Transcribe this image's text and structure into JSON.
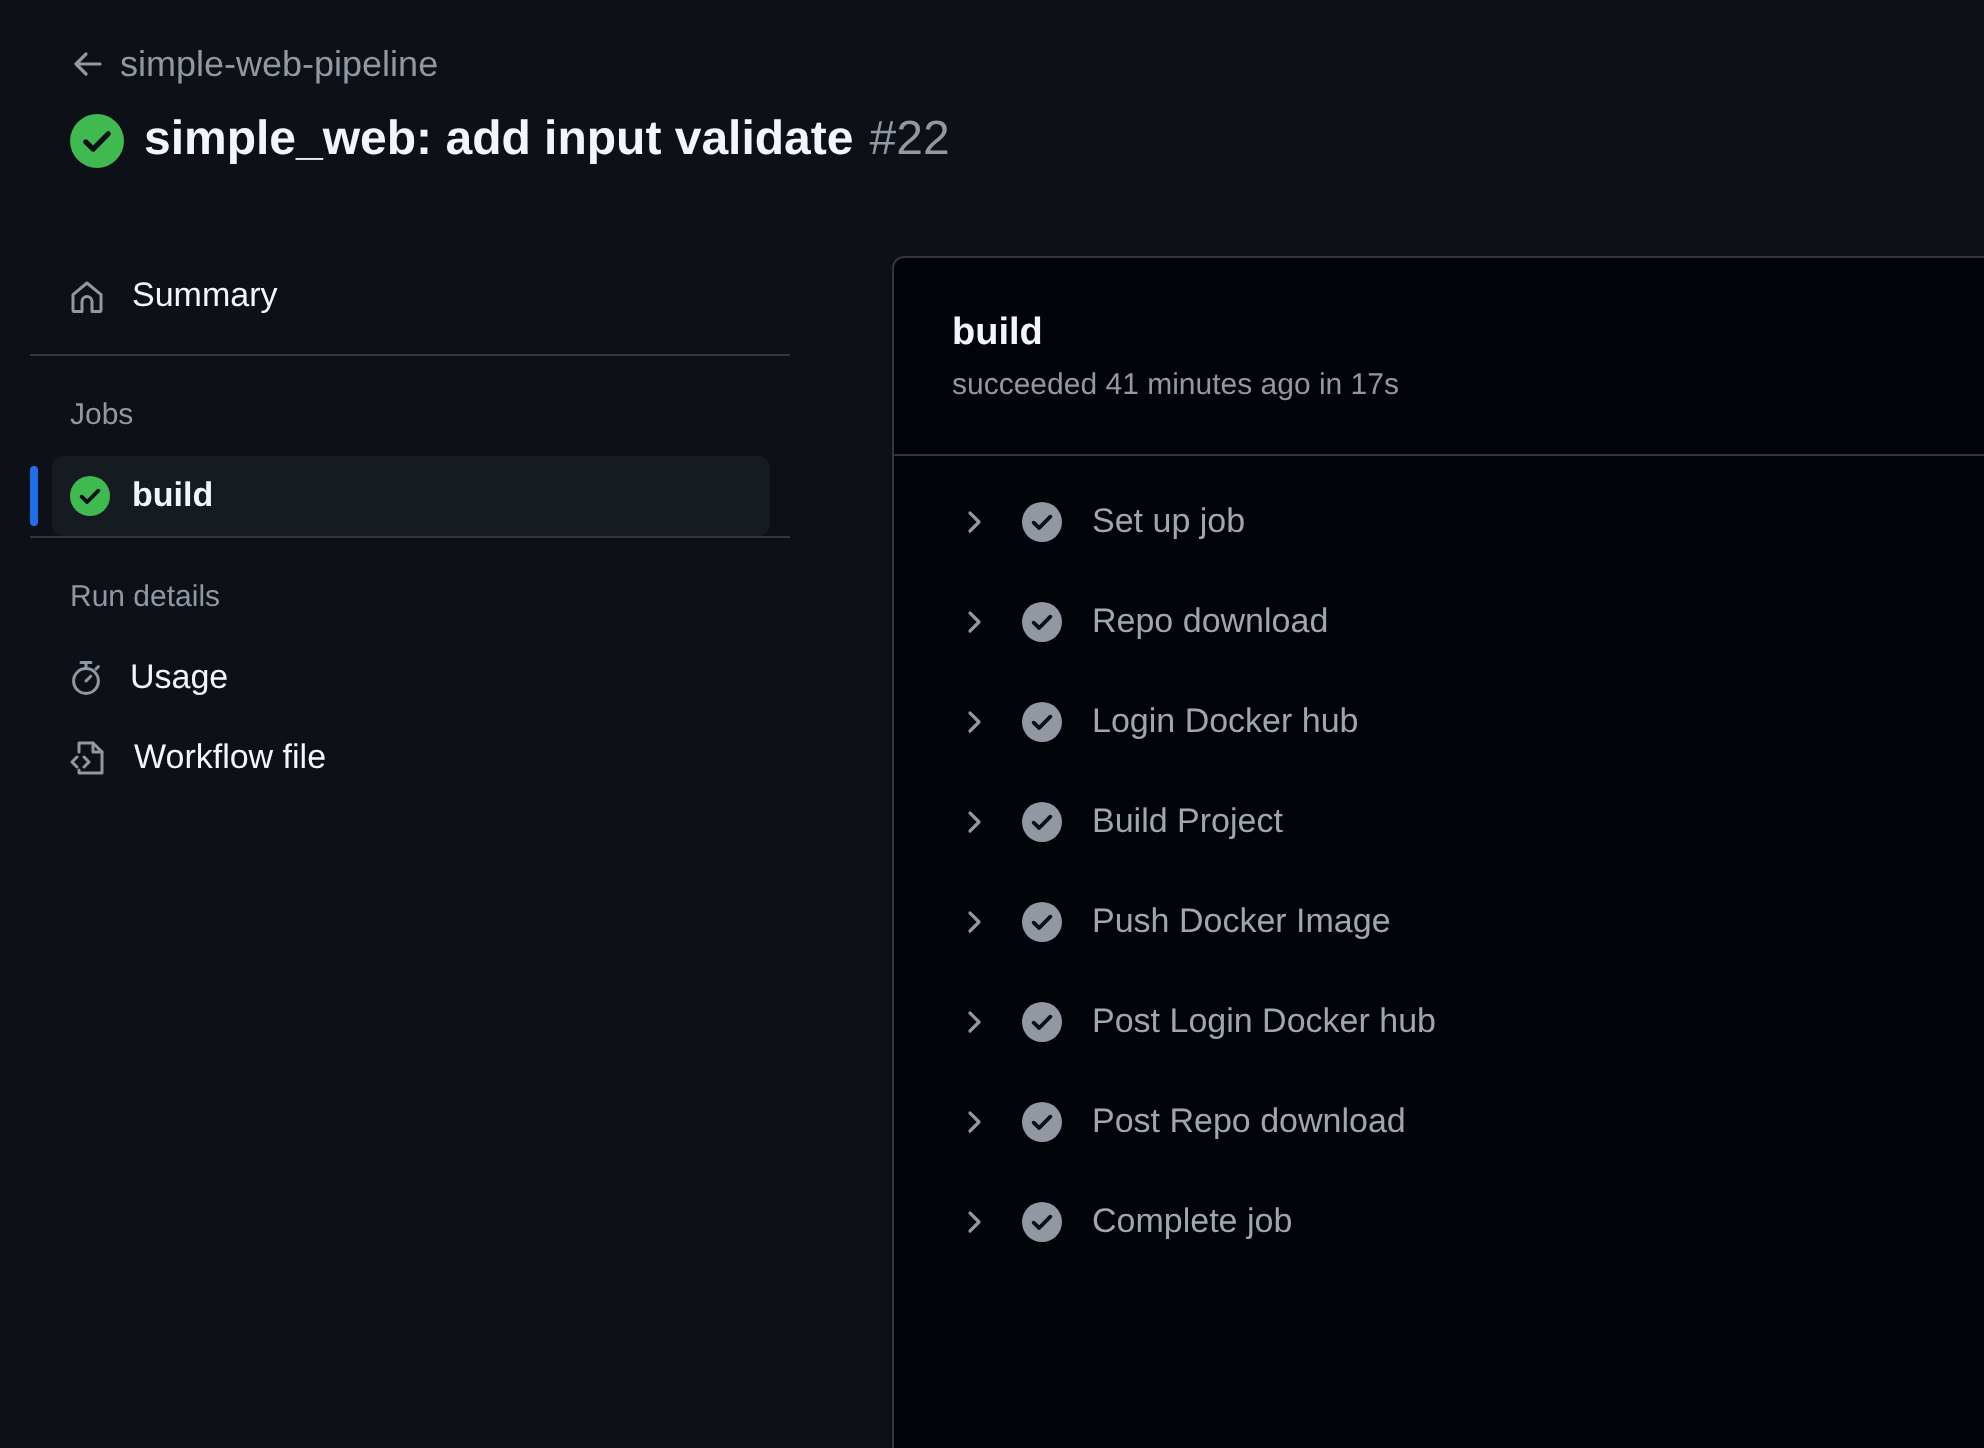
{
  "back_link": {
    "label": "simple-web-pipeline"
  },
  "run": {
    "success": true,
    "title": "simple_web: add input validate",
    "number": "#22"
  },
  "sidebar": {
    "summary": {
      "label": "Summary",
      "selected": false
    },
    "sections": [
      {
        "kind": "jobs",
        "heading": "Jobs",
        "items": [
          {
            "label": "build",
            "success": true,
            "selected": true
          }
        ]
      },
      {
        "kind": "links",
        "heading": "Run details",
        "items": [
          {
            "label": "Usage",
            "selected": false
          },
          {
            "label": "Workflow file",
            "selected": false
          }
        ]
      }
    ]
  },
  "job": {
    "title": "build",
    "summary": "succeeded 41 minutes ago in 17s",
    "steps": [
      {
        "name": "Set up job",
        "success": true,
        "expanded": false
      },
      {
        "name": "Repo download",
        "success": true,
        "expanded": false
      },
      {
        "name": "Login Docker hub",
        "success": true,
        "expanded": false
      },
      {
        "name": "Build Project",
        "success": true,
        "expanded": false
      },
      {
        "name": "Push Docker Image",
        "success": true,
        "expanded": false
      },
      {
        "name": "Post Login Docker hub",
        "success": true,
        "expanded": false
      },
      {
        "name": "Post Repo download",
        "success": true,
        "expanded": false
      },
      {
        "name": "Complete job",
        "success": true,
        "expanded": false
      }
    ]
  }
}
